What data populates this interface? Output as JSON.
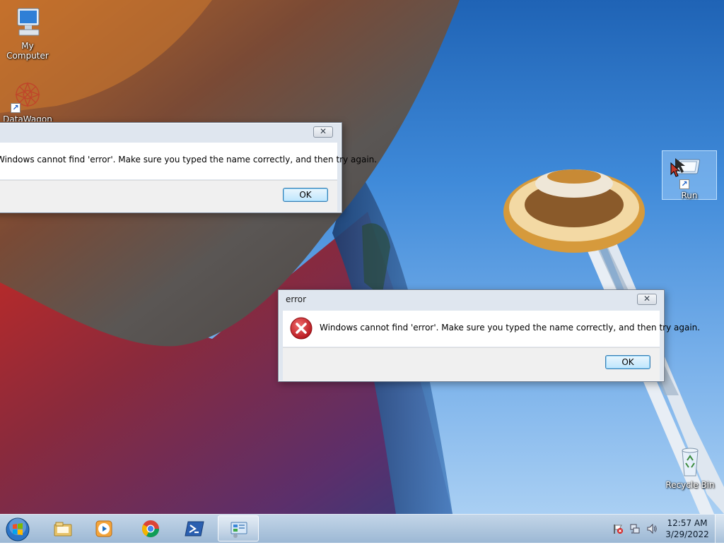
{
  "desktop": {
    "icons": [
      {
        "label": "My Computer",
        "icon": "computer-icon"
      },
      {
        "label": "DataWagon",
        "icon": "datawagon-icon"
      },
      {
        "label": "Run",
        "icon": "run-icon"
      },
      {
        "label": "Recycle Bin",
        "icon": "recycle-bin-icon"
      }
    ]
  },
  "dialogs": [
    {
      "title": "",
      "message": "Windows cannot find 'error'. Make sure you typed the name correctly, and then try again.",
      "ok_label": "OK",
      "close_glyph": "✕"
    },
    {
      "title": "error",
      "message": "Windows cannot find 'error'. Make sure you typed the name correctly, and then try again.",
      "ok_label": "OK",
      "close_glyph": "✕",
      "icon": "error-icon"
    }
  ],
  "taskbar": {
    "start": "start-orb-icon",
    "pinned": [
      "file-explorer-icon",
      "media-player-icon",
      "chrome-icon",
      "powershell-icon",
      "control-panel-icon"
    ],
    "tray": [
      "action-center-flag-icon",
      "network-icon",
      "volume-icon"
    ],
    "clock": {
      "time": "12:57 AM",
      "date": "3/29/2022"
    }
  },
  "colors": {
    "error_red": "#c8141c",
    "ok_button_border": "#3c7fb1"
  }
}
